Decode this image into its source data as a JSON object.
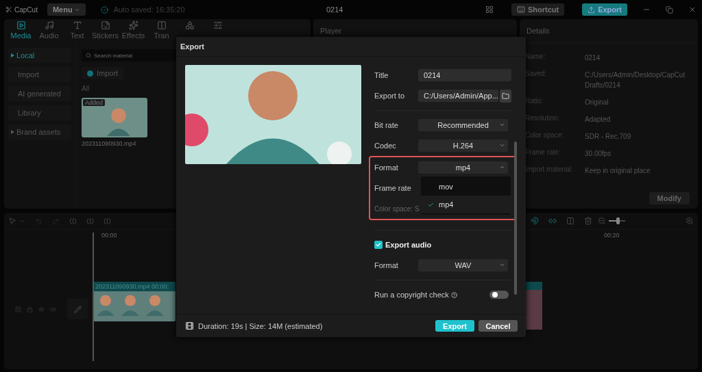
{
  "top_bar": {
    "app_name": "CapCut",
    "menu": "Menu",
    "autosave": "Auto saved: 16:35:20",
    "project_title": "0214",
    "shortcut": "Shortcut",
    "export": "Export"
  },
  "tool_tabs": [
    {
      "label": "Media",
      "selected": true
    },
    {
      "label": "Audio",
      "selected": false
    },
    {
      "label": "Text",
      "selected": false
    },
    {
      "label": "Stickers",
      "selected": false
    },
    {
      "label": "Effects",
      "selected": false
    },
    {
      "label": "Tran",
      "selected": false
    },
    {
      "selected": false
    },
    {
      "selected": false
    }
  ],
  "media_nav": [
    {
      "label": "Local",
      "selected": true,
      "kind": "group"
    },
    {
      "label": "Import",
      "selected": false,
      "kind": "item"
    },
    {
      "label": "AI generated",
      "selected": false,
      "kind": "item"
    },
    {
      "label": "Library",
      "selected": false,
      "kind": "item"
    },
    {
      "label": "Brand assets",
      "selected": false,
      "kind": "group"
    }
  ],
  "media": {
    "search_placeholder": "Search material",
    "import_button": "Import",
    "filter": "All",
    "items": [
      {
        "badge": "Added",
        "filename": "202311090930.mp4"
      }
    ]
  },
  "player": {
    "title": "Player"
  },
  "details": {
    "title": "Details",
    "rows": [
      {
        "label": "Name:",
        "value": "0214"
      },
      {
        "label": "Saved:",
        "value": "C:/Users/Admin/Desktop/CapCut Drafts/0214"
      },
      {
        "label": "Ratio:",
        "value": "Original"
      },
      {
        "label": "Resolution:",
        "value": "Adapted"
      },
      {
        "label": "Color space:",
        "value": "SDR - Rec.709"
      },
      {
        "label": "Frame rate:",
        "value": "30.00fps"
      },
      {
        "label": "Import material:",
        "value": "Keep in original place"
      }
    ],
    "modify_button": "Modify"
  },
  "timeline": {
    "zoom_slider": {
      "level": 0.55
    },
    "ruler_marks": [
      "00:00",
      "00:20"
    ],
    "clips": [
      {
        "label": "202311090930.mp4  00:00:"
      }
    ]
  },
  "export_dialog": {
    "title": "Export",
    "title_field": {
      "label": "Title",
      "value": "0214"
    },
    "export_to": {
      "label": "Export to",
      "value": "C:/Users/Admin/App..."
    },
    "video_settings": [
      {
        "kind": "select",
        "label": "Bit rate",
        "value": "Recommended",
        "expanded": false
      },
      {
        "kind": "select",
        "label": "Codec",
        "value": "H.264",
        "expanded": false
      }
    ],
    "highlighted_settings": [
      {
        "kind": "select",
        "label": "Format",
        "value": "mp4",
        "expanded": true
      },
      {
        "kind": "label",
        "label": "Frame rate"
      },
      {
        "kind": "note",
        "label": "Color space: S"
      }
    ],
    "format_menu": [
      {
        "label": "mov",
        "selected": false
      },
      {
        "label": "mp4",
        "selected": true
      }
    ],
    "export_audio": {
      "label": "Export audio",
      "checked": true
    },
    "audio_format": {
      "label": "Format",
      "value": "WAV",
      "expanded": false
    },
    "copyright_check": {
      "label": "Run a copyright check",
      "on": false
    },
    "summary": "Duration: 19s | Size: 14M (estimated)",
    "export_button": "Export",
    "cancel_button": "Cancel"
  }
}
